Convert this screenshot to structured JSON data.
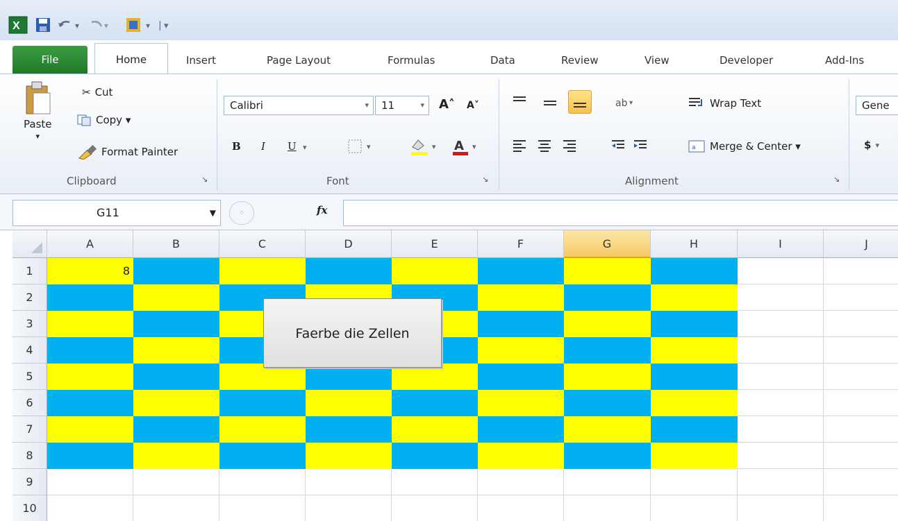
{
  "quick_access": {
    "icons": [
      "excel-logo-icon",
      "save-icon",
      "undo-icon",
      "redo-icon",
      "customize-qat-icon"
    ]
  },
  "tabs": [
    "File",
    "Home",
    "Insert",
    "Page Layout",
    "Formulas",
    "Data",
    "Review",
    "View",
    "Developer",
    "Add-Ins"
  ],
  "clipboard": {
    "paste": "Paste",
    "cut": "Cut",
    "copy": "Copy ▾",
    "format_painter": "Format Painter",
    "label": "Clipboard"
  },
  "font": {
    "name": "Calibri",
    "size": "11",
    "label": "Font",
    "bold": "B",
    "italic": "I",
    "underline": "U"
  },
  "alignment": {
    "wrap_text": "Wrap Text",
    "merge_center": "Merge & Center ▾",
    "label": "Alignment"
  },
  "number": {
    "format": "Gene",
    "currency": "$"
  },
  "formula_bar": {
    "name_box": "G11",
    "fx": "fx",
    "value": ""
  },
  "columns": [
    "A",
    "B",
    "C",
    "D",
    "E",
    "F",
    "G",
    "H",
    "I",
    "J"
  ],
  "selected_column": "G",
  "rows": [
    "1",
    "2",
    "3",
    "4",
    "5",
    "6",
    "7",
    "8",
    "9",
    "10"
  ],
  "cell_value_A1": "8",
  "colors": {
    "yellow": "#ffff00",
    "blue": "#00b0f0"
  },
  "macro_button": "Faerbe die Zellen"
}
